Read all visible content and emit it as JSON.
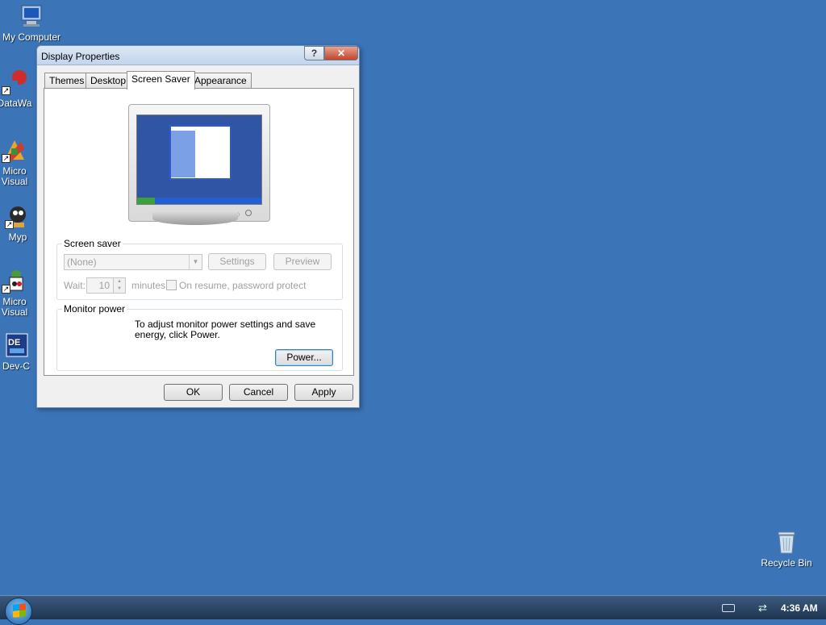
{
  "desktop": {
    "icons": [
      {
        "label": "My Computer"
      },
      {
        "label": "DataWa"
      },
      {
        "label": "Micro Visual"
      },
      {
        "label": "Myp"
      },
      {
        "label": "Micro Visual"
      },
      {
        "label": "Dev-C"
      },
      {
        "label": "Recycle Bin"
      }
    ]
  },
  "window": {
    "title": "Display Properties",
    "help_glyph": "?",
    "close_glyph": "✕",
    "tabs": [
      {
        "label": "Themes",
        "active": false
      },
      {
        "label": "Desktop",
        "active": false
      },
      {
        "label": "Screen Saver",
        "active": true
      },
      {
        "label": "Appearance",
        "active": false
      }
    ],
    "screen_saver": {
      "group_label": "Screen saver",
      "selected": "(None)",
      "settings_label": "Settings",
      "preview_label": "Preview",
      "wait_label": "Wait:",
      "wait_value": "10",
      "minutes_label": "minutes",
      "resume_label": "On resume, password protect"
    },
    "monitor_power": {
      "group_label": "Monitor power",
      "description": "To adjust monitor power settings and save energy, click Power.",
      "power_label": "Power..."
    },
    "buttons": {
      "ok": "OK",
      "cancel": "Cancel",
      "apply": "Apply"
    }
  },
  "taskbar": {
    "clock": "4:36 AM"
  },
  "colors": {
    "desktop": "#3b74b7",
    "taskbar": "#1e3550"
  }
}
